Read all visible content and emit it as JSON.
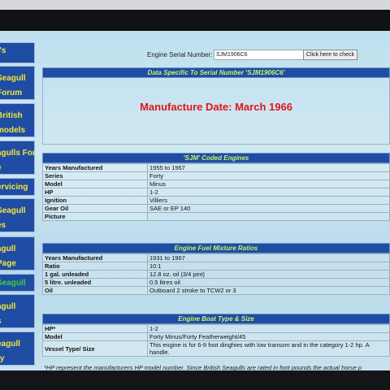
{
  "sidebar": {
    "items": [
      {
        "label": "t's",
        "color": "yellow"
      },
      {
        "label": "Seagull",
        "label2": "Forum",
        "color": "yellow"
      },
      {
        "label": "British",
        "label2": "models",
        "color": "yellow"
      },
      {
        "label": "agulls For",
        "label2": "e",
        "color": "yellow"
      },
      {
        "label": "ervicing",
        "color": "yellow"
      },
      {
        "label": "Seagull",
        "label2": "es",
        "color": "yellow"
      },
      {
        "label": "agull",
        "label2": "Page",
        "color": "yellow"
      },
      {
        "label": "Seagull",
        "color": "green"
      },
      {
        "label": "agull",
        "label2": "s",
        "color": "yellow"
      },
      {
        "label": "eagull",
        "label2": "ry",
        "color": "yellow"
      }
    ]
  },
  "search": {
    "label": "Engine Serial Number:",
    "value": "SJM1906C6",
    "button": "Click here to check"
  },
  "serial_section": {
    "title": "Data Specific To Serial Number 'SJM1906C6'",
    "manufacture_date": "Manufacture Date: March 1966"
  },
  "coded_section": {
    "title": "'SJM' Coded Engines",
    "rows": [
      {
        "k": "Years Manufactured",
        "v": "1955 to 1967"
      },
      {
        "k": "Series",
        "v": "Forty"
      },
      {
        "k": "Model",
        "v": "Minus"
      },
      {
        "k": "HP",
        "v": "1-2"
      },
      {
        "k": "Ignition",
        "v": "Villiers"
      },
      {
        "k": "Gear Oil",
        "v": "SAE or EP 140"
      },
      {
        "k": "Picture",
        "v": ""
      }
    ]
  },
  "fuel_section": {
    "title": "Engine Fuel Mixture Ratios",
    "rows": [
      {
        "k": "Years Manufactured",
        "v": "1931 to 1967"
      },
      {
        "k": "Ratio",
        "v": "10:1"
      },
      {
        "k": "1 gal. unleaded",
        "v": "12.8 oz. oil (3/4 pint)"
      },
      {
        "k": "5 litre. unleaded",
        "v": "0.5 litres oil"
      },
      {
        "k": "Oil",
        "v": "Outboard 2 stroke to TCW2 or 3"
      }
    ]
  },
  "boat_section": {
    "title": "Engine Boat Type & Size",
    "rows": [
      {
        "k": "HP*",
        "v": "1-2"
      },
      {
        "k": "Model",
        "v": "Forty Minus/Forty Featherweight/45"
      },
      {
        "k": "Vessel Type/ Size",
        "v": "This engine is for 6-9 foot dinghies with low transom and in the category 1-2 hp. A handle."
      }
    ]
  },
  "footnote": "*HP represent the manufacturers HP model number. Since British Seagulls are rated in foot pounds the actual horse p"
}
